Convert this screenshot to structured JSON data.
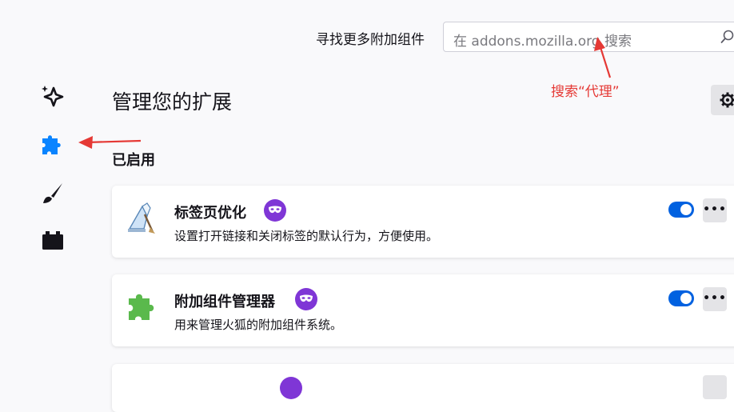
{
  "header": {
    "find_more_label": "寻找更多附加组件",
    "search_placeholder": "在 addons.mozilla.org 搜索"
  },
  "sidebar": {
    "items": [
      {
        "name": "recommendations",
        "icon": "sparkle-icon"
      },
      {
        "name": "extensions",
        "icon": "puzzle-icon",
        "active": true
      },
      {
        "name": "themes",
        "icon": "brush-icon"
      },
      {
        "name": "plugins",
        "icon": "plugin-icon"
      }
    ]
  },
  "main": {
    "title": "管理您的扩展",
    "section_enabled": "已启用",
    "extensions": [
      {
        "name": "标签页优化",
        "description": "设置打开链接和关闭标签的默认行为，方便使用。",
        "enabled": true,
        "more_label": "•••"
      },
      {
        "name": "附加组件管理器",
        "description": "用来管理火狐的附加组件系统。",
        "enabled": true,
        "more_label": "•••"
      }
    ]
  },
  "annotation": {
    "text": "搜索“代理”",
    "color": "#e53935"
  },
  "colors": {
    "accent": "#0061e0",
    "badge": "#7f36d6",
    "active_icon": "#0a84ff"
  }
}
